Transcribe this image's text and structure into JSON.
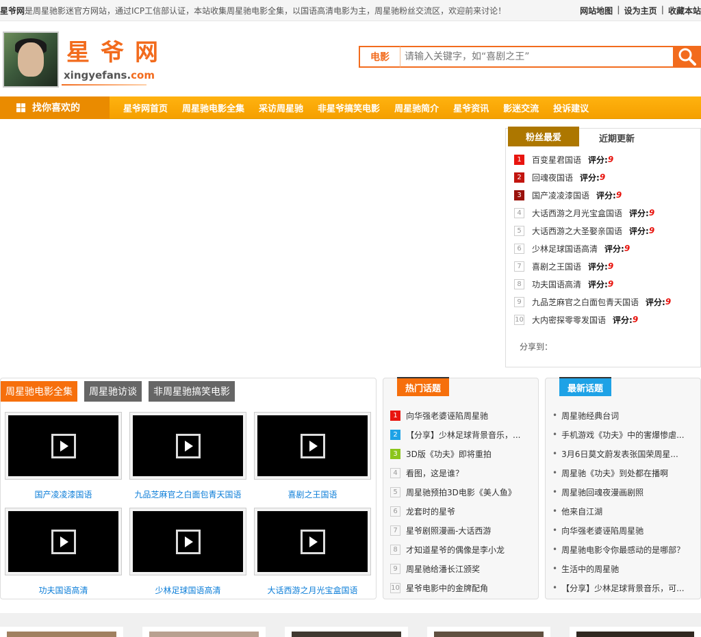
{
  "topbar": {
    "site_name": "星爷网",
    "intro": "是周星驰影迷官方网站，通过ICP工信部认证，本站收集周星驰电影全集，以国语高清电影为主，周星驰粉丝交流区，欢迎前来讨论！",
    "links": [
      "网站地图",
      "设为主页",
      "收藏本站"
    ]
  },
  "header": {
    "logo_cn": "星爷网",
    "logo_en_main": "xingyefans.",
    "logo_en_dom": "com"
  },
  "search": {
    "category": "电影",
    "placeholder": "请输入关键字，如“喜剧之王”"
  },
  "nav": {
    "fav_label": "找你喜欢的",
    "items": [
      "星爷网首页",
      "周星驰电影全集",
      "采访周星驰",
      "非星爷搞笑电影",
      "周星驰简介",
      "星爷资讯",
      "影迷交流",
      "投诉建议"
    ]
  },
  "rank": {
    "tab_active": "粉丝最爱",
    "tab_inactive": "近期更新",
    "score_label": "评分:",
    "items": [
      {
        "num": "1",
        "title": "百变星君国语",
        "score": "9"
      },
      {
        "num": "2",
        "title": "回魂夜国语",
        "score": "9"
      },
      {
        "num": "3",
        "title": "国产凌凌漆国语",
        "score": "9"
      },
      {
        "num": "4",
        "title": "大话西游之月光宝盒国语",
        "score": "9"
      },
      {
        "num": "5",
        "title": "大话西游之大圣娶亲国语",
        "score": "9"
      },
      {
        "num": "6",
        "title": "少林足球国语高清",
        "score": "9"
      },
      {
        "num": "7",
        "title": "喜剧之王国语",
        "score": "9"
      },
      {
        "num": "8",
        "title": "功夫国语高清",
        "score": "9"
      },
      {
        "num": "9",
        "title": "九品芝麻官之白面包青天国语",
        "score": "9"
      },
      {
        "num": "10",
        "title": "大内密探零零发国语",
        "score": "9"
      }
    ],
    "share_label": "分享到："
  },
  "movies": {
    "tabs": [
      "周星驰电影全集",
      "周星驰访谈",
      "非周星驰搞笑电影"
    ],
    "items": [
      "国产凌凌漆国语",
      "九品芝麻官之白面包青天国语",
      "喜剧之王国语",
      "功夫国语高清",
      "少林足球国语高清",
      "大话西游之月光宝盒国语"
    ]
  },
  "hot": {
    "title": "热门话题",
    "items": [
      {
        "num": "1",
        "text": "向华强老婆诬陷周星驰"
      },
      {
        "num": "2",
        "text": "【分享】少林足球背景音乐，..."
      },
      {
        "num": "3",
        "text": "3D版《功夫》即将重拍"
      },
      {
        "num": "4",
        "text": "看图，这是谁？"
      },
      {
        "num": "5",
        "text": "周星驰预拍3D电影《美人鱼》"
      },
      {
        "num": "6",
        "text": "龙套时的星爷"
      },
      {
        "num": "7",
        "text": "星爷剧照漫画-大话西游"
      },
      {
        "num": "8",
        "text": "才知道星爷的偶像是李小龙"
      },
      {
        "num": "9",
        "text": "周星驰给潘长江颁奖"
      },
      {
        "num": "10",
        "text": "星爷电影中的金牌配角"
      }
    ]
  },
  "newest": {
    "title": "最新话题",
    "items": [
      "周星驰经典台词",
      "手机游戏《功夫》中的害爆惨虐...",
      "3月6日莫文蔚发表张国荣周星...",
      "周星驰《功夫》到处都在播啊",
      "周星驰回魂夜漫画剧照",
      "他来自江湖",
      "向华强老婆诬陷周星驰",
      "周星驰电影令你最感动的是哪部？",
      "生活中的周星驰",
      "【分享】少林足球背景音乐，可..."
    ]
  },
  "colors": {
    "accent_orange": "#f26b1d",
    "nav_yellow": "#ffb20f",
    "topic_blue": "#1ea2e6",
    "link_blue": "#0b7dd8"
  }
}
